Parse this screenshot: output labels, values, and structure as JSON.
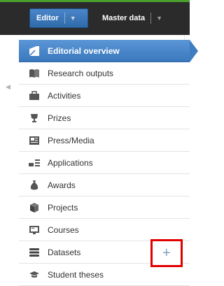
{
  "topbar": {
    "tabs": [
      {
        "label": "Editor"
      },
      {
        "label": "Master data"
      }
    ]
  },
  "nav": {
    "items": [
      {
        "label": "Editorial overview",
        "icon": "editorial-icon",
        "active": true
      },
      {
        "label": "Research outputs",
        "icon": "book-icon"
      },
      {
        "label": "Activities",
        "icon": "briefcase-icon"
      },
      {
        "label": "Prizes",
        "icon": "trophy-icon"
      },
      {
        "label": "Press/Media",
        "icon": "newspaper-icon"
      },
      {
        "label": "Applications",
        "icon": "applications-icon"
      },
      {
        "label": "Awards",
        "icon": "money-bag-icon"
      },
      {
        "label": "Projects",
        "icon": "cube-icon"
      },
      {
        "label": "Courses",
        "icon": "courses-icon"
      },
      {
        "label": "Datasets",
        "icon": "database-icon"
      },
      {
        "label": "Student theses",
        "icon": "graduation-cap-icon"
      }
    ],
    "add_button": "+"
  },
  "colors": {
    "accent": "#3a78bd",
    "highlight_box": "#e00000",
    "topbar": "#2b2b2b"
  }
}
